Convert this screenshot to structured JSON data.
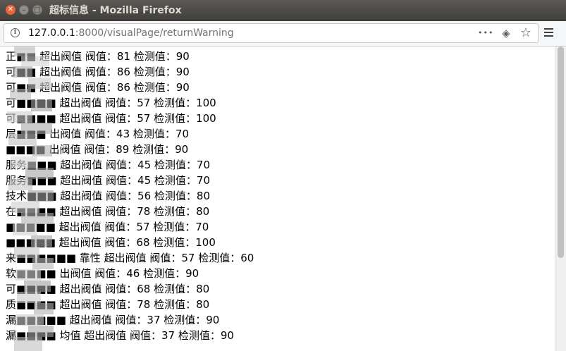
{
  "window": {
    "title": "超标信息 - Mozilla Firefox",
    "close_glyph": "✕",
    "min_glyph": "–",
    "max_glyph": "□"
  },
  "urlbar": {
    "host": "127.0.0.1",
    "rest": ":8000/visualPage/returnWarning",
    "info_glyph": "i",
    "more_glyph": "•••",
    "pocket_glyph": "◈",
    "bookmark_glyph": "☆"
  },
  "icons": [
    "info-icon",
    "page-actions-icon",
    "pocket-icon",
    "bookmark-star-icon",
    "hamburger-menu-icon"
  ],
  "warnings": [
    "正■■ 超出阀值 阀值：81 检测值：90",
    "可■■ 超出阀值 阀值：86 检测值：90",
    "可■■ 超出阀值 阀值：86 检测值：90",
    "可■■■■ 超出阀值 阀值：57 检测值：100",
    "可■■■■ 超出阀值 阀值：57 检测值：100",
    "层■■■ 出阀值 阀值：43 检测值：70",
    "■■■■ 出阀值 阀值：89 检测值：90",
    "服务■■■ 超出阀值 阀值：45 检测值：70",
    "服务■■■ 超出阀值 阀值：45 检测值：70",
    "技术■■■ 超出阀值 阀值：56 检测值：80",
    "在■■■■ 超出阀值 阀值：78 检测值：80",
    "■■■■■ 超出阀值 阀值：57 检测值：70",
    "■■■■■ 超出阀值 阀值：68 检测值：100",
    "来■■■■■■ 靠性 超出阀值 阀值：57 检测值：60",
    "软■■■■ 出阀值 阀值：46 检测值：90",
    "可■■■■ 超出阀值 阀值：68 检测值：80",
    "质■■■■ 超出阀值 阀值：78 检测值：80",
    "漏■■■■■ 超出阀值 阀值：37 检测值：90",
    "漏■■■■ 均值 超出阀值 阀值：37 检测值：90"
  ],
  "colors": {
    "titlebar_bg": "#4a4945",
    "close_button": "#e8643b",
    "text": "#000000",
    "url_host": "#15141a",
    "url_rest": "#737373"
  }
}
